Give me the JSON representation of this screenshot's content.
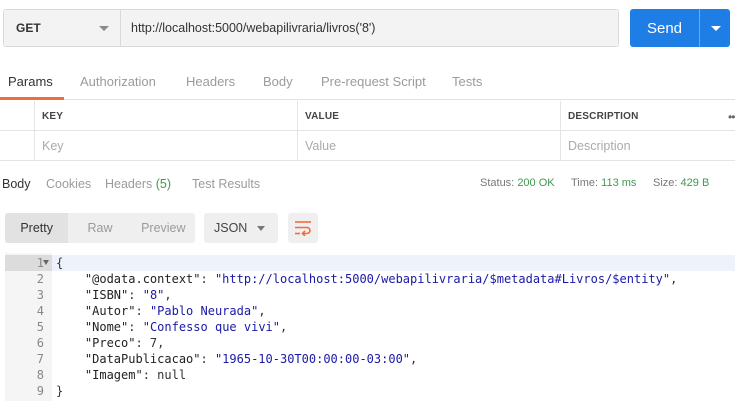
{
  "request": {
    "method": "GET",
    "url": "http://localhost:5000/webapilivraria/livros('8')",
    "send_label": "Send"
  },
  "request_tabs": [
    "Params",
    "Authorization",
    "Headers",
    "Body",
    "Pre-request Script",
    "Tests"
  ],
  "params": {
    "headers": [
      "KEY",
      "VALUE",
      "DESCRIPTION"
    ],
    "placeholders": [
      "Key",
      "Value",
      "Description"
    ]
  },
  "response_tabs": {
    "body": "Body",
    "cookies": "Cookies",
    "headers": "Headers",
    "headers_count": "(5)",
    "test_results": "Test Results"
  },
  "response_meta": {
    "status_label": "Status:",
    "status_value": "200 OK",
    "time_label": "Time:",
    "time_value": "113 ms",
    "size_label": "Size:",
    "size_value": "429 B"
  },
  "view_modes": [
    "Pretty",
    "Raw",
    "Preview"
  ],
  "format": "JSON",
  "response_lines": [
    {
      "n": "1",
      "parts": [
        [
          "n",
          "{"
        ]
      ]
    },
    {
      "n": "2",
      "parts": [
        [
          "n",
          "    "
        ],
        [
          "k",
          "\"@odata.context\""
        ],
        [
          "n",
          ": "
        ],
        [
          "s",
          "\"http://localhost:5000/webapilivraria/$metadata#Livros/$entity\""
        ],
        [
          "n",
          ","
        ]
      ]
    },
    {
      "n": "3",
      "parts": [
        [
          "n",
          "    "
        ],
        [
          "k",
          "\"ISBN\""
        ],
        [
          "n",
          ": "
        ],
        [
          "s",
          "\"8\""
        ],
        [
          "n",
          ","
        ]
      ]
    },
    {
      "n": "4",
      "parts": [
        [
          "n",
          "    "
        ],
        [
          "k",
          "\"Autor\""
        ],
        [
          "n",
          ": "
        ],
        [
          "s",
          "\"Pablo Neurada\""
        ],
        [
          "n",
          ","
        ]
      ]
    },
    {
      "n": "5",
      "parts": [
        [
          "n",
          "    "
        ],
        [
          "k",
          "\"Nome\""
        ],
        [
          "n",
          ": "
        ],
        [
          "s",
          "\"Confesso que vivi\""
        ],
        [
          "n",
          ","
        ]
      ]
    },
    {
      "n": "6",
      "parts": [
        [
          "n",
          "    "
        ],
        [
          "k",
          "\"Preco\""
        ],
        [
          "n",
          ": 7,"
        ]
      ]
    },
    {
      "n": "7",
      "parts": [
        [
          "n",
          "    "
        ],
        [
          "k",
          "\"DataPublicacao\""
        ],
        [
          "n",
          ": "
        ],
        [
          "s",
          "\"1965-10-30T00:00:00-03:00\""
        ],
        [
          "n",
          ","
        ]
      ]
    },
    {
      "n": "8",
      "parts": [
        [
          "n",
          "    "
        ],
        [
          "k",
          "\"Imagem\""
        ],
        [
          "n",
          ": null"
        ]
      ]
    },
    {
      "n": "9",
      "parts": [
        [
          "n",
          "}"
        ]
      ]
    }
  ],
  "colors": {
    "send": "#1f7de6",
    "accent_underline": "#f26b3a",
    "status_ok": "#3e9a4f",
    "string": "#1a1aa6"
  }
}
